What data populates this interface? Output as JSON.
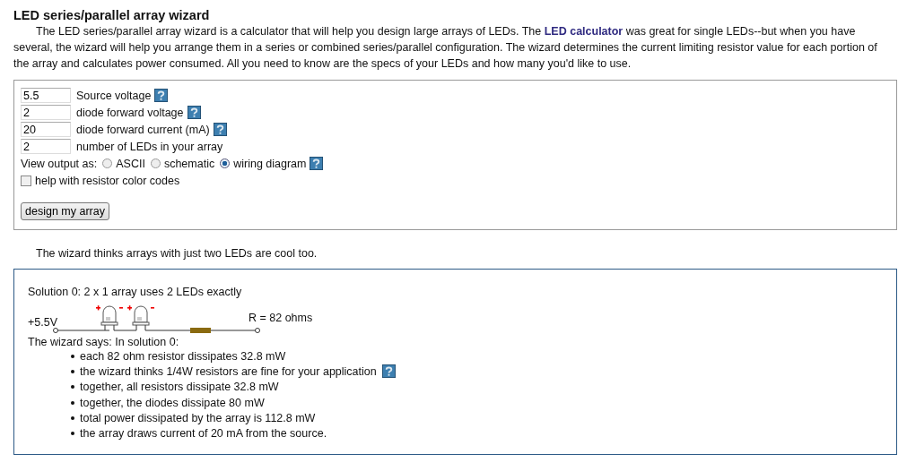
{
  "title": "LED series/parallel array wizard",
  "intro": {
    "before": "The LED series/parallel array wizard is a calculator that will help you design large arrays of LEDs. The ",
    "link": "LED calculator",
    "after": " was great for single LEDs--but when you have several, the wizard will help you arrange them in a series or combined series/parallel configuration. The wizard determines the current limiting resistor value for each portion of the array and calculates power consumed. All you need to know are the specs of your LEDs and how many you'd like to use."
  },
  "fields": [
    {
      "value": "5.5",
      "label": "Source voltage",
      "help": true
    },
    {
      "value": "2",
      "label": "diode forward voltage",
      "help": true
    },
    {
      "value": "20",
      "label": "diode forward current (mA)",
      "help": true
    },
    {
      "value": "2",
      "label": "number of LEDs in your array",
      "help": false
    }
  ],
  "output": {
    "label": "View output as:",
    "help": true,
    "options": [
      {
        "label": "ASCII",
        "selected": false
      },
      {
        "label": "schematic",
        "selected": false
      },
      {
        "label": "wiring diagram",
        "selected": true
      }
    ]
  },
  "color_codes": {
    "label": "help with resistor color codes",
    "checked": false
  },
  "button": "design my array",
  "note": "The wizard thinks arrays with just two LEDs are cool too.",
  "solution": {
    "heading": "Solution 0: 2 x 1 array uses 2 LEDs exactly",
    "source": "+5.5V",
    "resistor": "R = 82 ohms",
    "says": "The wizard says: In solution 0:",
    "bullets": [
      {
        "text": "each 82 ohm resistor dissipates 32.8 mW",
        "help": false
      },
      {
        "text": "the wizard thinks 1/4W resistors are fine for your application",
        "help": true
      },
      {
        "text": "together, all resistors dissipate 32.8 mW",
        "help": false
      },
      {
        "text": "together, the diodes dissipate 80 mW",
        "help": false
      },
      {
        "text": "total power dissipated by the array is 112.8 mW",
        "help": false
      },
      {
        "text": "the array draws current of 20 mA from the source.",
        "help": false
      }
    ]
  }
}
